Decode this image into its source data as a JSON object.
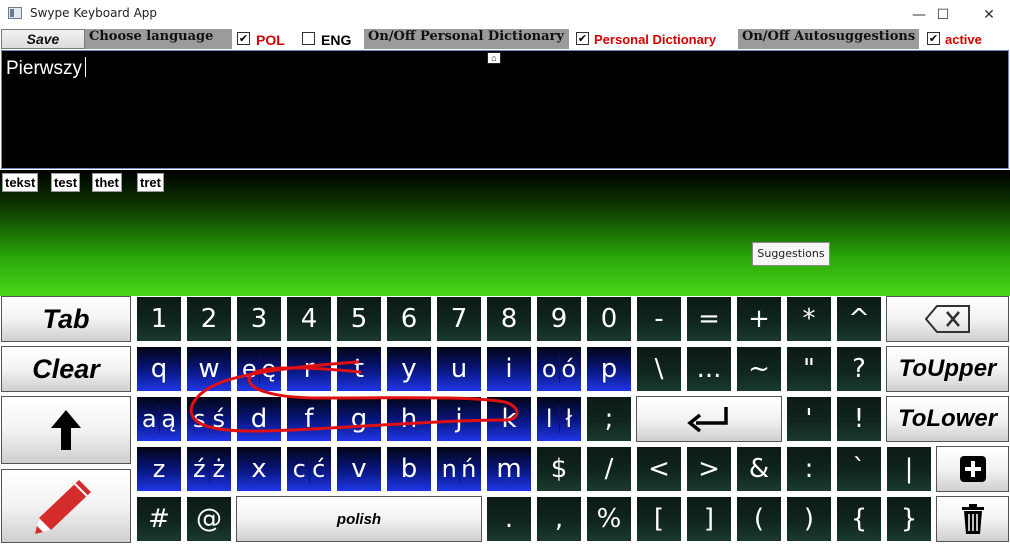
{
  "window": {
    "title": "Swype Keyboard App",
    "minimize_glyph": "—",
    "maximize_glyph": "☐",
    "close_glyph": "✕"
  },
  "toolbar": {
    "save_label": "Save",
    "choose_language_label": "Choose language",
    "pol_label": "POL",
    "pol_checked": true,
    "eng_label": "ENG",
    "eng_checked": false,
    "personal_dict_toggle_label": "On/Off Personal Dictionary",
    "personal_dict_label": "Personal Dictionary",
    "personal_dict_checked": true,
    "autosuggest_toggle_label": "On/Off Autosuggestions",
    "active_label": "active",
    "active_checked": true,
    "check_glyph": "✔",
    "accent_red": "#d40000"
  },
  "editor": {
    "text": "Pierwszy",
    "lock_icon": "unlock-icon"
  },
  "suggestions": {
    "chips": [
      "tekst",
      "test",
      "thet",
      "tret"
    ],
    "tooltip": "Suggestions"
  },
  "keyboard": {
    "row1": {
      "tab": "Tab",
      "digits": [
        "1",
        "2",
        "3",
        "4",
        "5",
        "6",
        "7",
        "8",
        "9",
        "0"
      ],
      "symbols": [
        "-",
        "=",
        "+",
        "*",
        "^"
      ],
      "backspace_icon": "backspace-icon"
    },
    "row2": {
      "clear": "Clear",
      "letters": [
        [
          "q"
        ],
        [
          "w"
        ],
        [
          "e",
          "ę"
        ],
        [
          "r"
        ],
        [
          "t"
        ],
        [
          "y"
        ],
        [
          "u"
        ],
        [
          "i"
        ],
        [
          "o",
          "ó"
        ],
        [
          "p"
        ]
      ],
      "symbols": [
        "\\",
        "...",
        "~",
        "\"",
        "?"
      ],
      "to_upper": "ToUpper"
    },
    "row3": {
      "shift_icon": "up-arrow-icon",
      "letters": [
        [
          "a",
          "ą"
        ],
        [
          "s",
          "ś"
        ],
        [
          "d"
        ],
        [
          "f"
        ],
        [
          "g"
        ],
        [
          "h"
        ],
        [
          "j"
        ],
        [
          "k"
        ],
        [
          "l",
          "ł"
        ]
      ],
      "semicolon": ";",
      "enter_icon": "enter-icon",
      "symbols": [
        "'",
        "!"
      ],
      "to_lower": "ToLower"
    },
    "row4": {
      "pencil_icon": "pencil-icon",
      "letters": [
        [
          "z",
          "ź",
          "ż"
        ],
        [
          "x"
        ],
        [
          "c",
          "ć"
        ],
        [
          "v"
        ],
        [
          "b"
        ],
        [
          "n",
          "ń"
        ],
        [
          "m"
        ]
      ],
      "symbols": [
        "$",
        "/",
        "<",
        ">",
        "&",
        ":",
        "`",
        "|"
      ],
      "add_icon": "plus-box-icon"
    },
    "row5": {
      "symbols_left": [
        "#",
        "@"
      ],
      "space_label": "polish",
      "symbols_right": [
        ".",
        ",",
        "%",
        "[",
        "]",
        "(",
        ")",
        "{",
        "}"
      ],
      "trash_icon": "trash-icon"
    },
    "swipe_color": "#e01010"
  }
}
